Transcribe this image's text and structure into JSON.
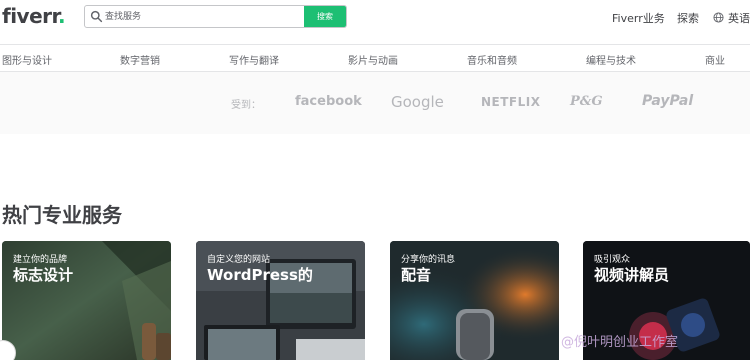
{
  "header": {
    "logo_text": "fiverr",
    "logo_dot": ".",
    "search_placeholder": "查找服务",
    "search_button": "搜索",
    "business": "Fiverr业务",
    "explore": "探索",
    "language": "英语"
  },
  "categories": [
    "图形与设计",
    "数字营销",
    "写作与翻译",
    "影片与动画",
    "音乐和音频",
    "编程与技术",
    "商业"
  ],
  "trusted": {
    "label": "受到：",
    "brands": [
      "facebook",
      "Google",
      "NETFLIX",
      "P&G",
      "PayPal"
    ]
  },
  "section_title": "热门专业服务",
  "cards": [
    {
      "subtitle": "建立你的品牌",
      "title": "标志设计"
    },
    {
      "subtitle": "自定义您的网站",
      "title": "WordPress的"
    },
    {
      "subtitle": "分享你的讯息",
      "title": "配音"
    },
    {
      "subtitle": "吸引观众",
      "title": "视频讲解员"
    }
  ],
  "watermark": "@倪叶明创业工作室",
  "colors": {
    "brand_green": "#1dbf73",
    "text_dark": "#404145",
    "logo_grey": "#b5b6ba"
  }
}
